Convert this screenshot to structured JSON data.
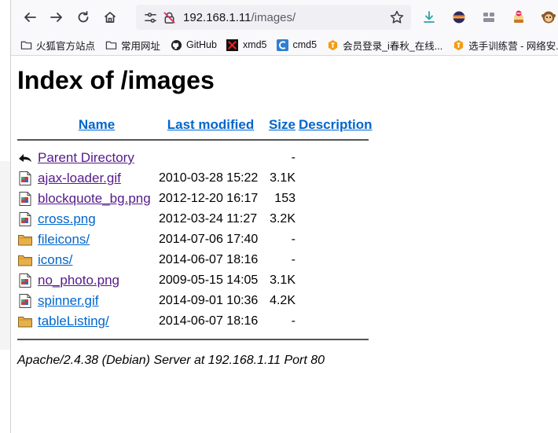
{
  "browser": {
    "url_host": "192.168.1.11",
    "url_path": "/images/",
    "bookmarks": [
      {
        "label": "火狐官方站点",
        "icon": "folder-icon"
      },
      {
        "label": "常用网址",
        "icon": "folder-icon"
      },
      {
        "label": "GitHub",
        "icon": "github-icon"
      },
      {
        "label": "xmd5",
        "icon": "xmd5-icon"
      },
      {
        "label": "cmd5",
        "icon": "cmd5-icon"
      },
      {
        "label": "会员登录_i春秋_在线...",
        "icon": "ichunqiu-icon"
      },
      {
        "label": "选手训练营 - 网络安...",
        "icon": "ichunqiu-icon"
      }
    ]
  },
  "page": {
    "title": "Index of /images",
    "headers": {
      "name": "Name",
      "last_modified": "Last modified",
      "size": "Size",
      "description": "Description"
    },
    "parent": {
      "name": "Parent Directory",
      "date": "",
      "size": "-"
    },
    "entries": [
      {
        "name": "ajax-loader.gif",
        "date": "2010-03-28 15:22",
        "size": "3.1K",
        "type": "image",
        "visited": true
      },
      {
        "name": "blockquote_bg.png",
        "date": "2012-12-20 16:17",
        "size": "153",
        "type": "image",
        "visited": true
      },
      {
        "name": "cross.png",
        "date": "2012-03-24 11:27",
        "size": "3.2K",
        "type": "image",
        "visited": false
      },
      {
        "name": "fileicons/",
        "date": "2014-07-06 17:40",
        "size": "-",
        "type": "folder",
        "visited": false
      },
      {
        "name": "icons/",
        "date": "2014-06-07 18:16",
        "size": "-",
        "type": "folder",
        "visited": false
      },
      {
        "name": "no_photo.png",
        "date": "2009-05-15 14:05",
        "size": "3.1K",
        "type": "image",
        "visited": true
      },
      {
        "name": "spinner.gif",
        "date": "2014-09-01 10:36",
        "size": "4.2K",
        "type": "image",
        "visited": false
      },
      {
        "name": "tableListing/",
        "date": "2014-06-07 18:16",
        "size": "-",
        "type": "folder",
        "visited": false
      }
    ],
    "server_signature": "Apache/2.4.38 (Debian) Server at 192.168.1.11 Port 80"
  },
  "colors": {
    "link": "#0066cc",
    "visited": "#551a8b"
  }
}
